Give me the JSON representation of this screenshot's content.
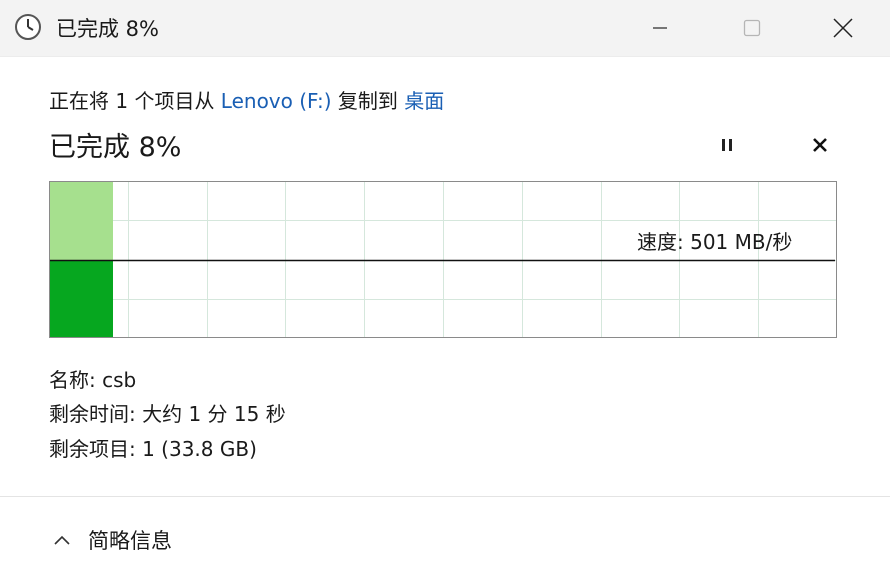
{
  "window": {
    "title": "已完成 8%"
  },
  "operation": {
    "prefix": "正在将 1 个项目从 ",
    "source": "Lenovo (F:)",
    "middle": " 复制到 ",
    "destination": "桌面"
  },
  "progress": {
    "label": "已完成 8%",
    "percent": 8
  },
  "speed": {
    "label": "速度: 501 MB/秒"
  },
  "details": {
    "name": "名称: csb",
    "time_remaining": "剩余时间: 大约 1 分 15 秒",
    "items_remaining": "剩余项目: 1 (33.8 GB)"
  },
  "footer": {
    "toggle_label": "简略信息"
  },
  "icons": {
    "title": "clock-icon",
    "minimize": "minimize-icon",
    "maximize": "maximize-icon",
    "close": "close-icon",
    "pause": "pause-icon",
    "cancel": "cancel-icon",
    "collapse": "chevron-up-icon"
  },
  "colors": {
    "progress_light": "#a6e08e",
    "progress_dark": "#06a71f",
    "grid": "#d5e7dc",
    "link": "#1a5fb4"
  }
}
